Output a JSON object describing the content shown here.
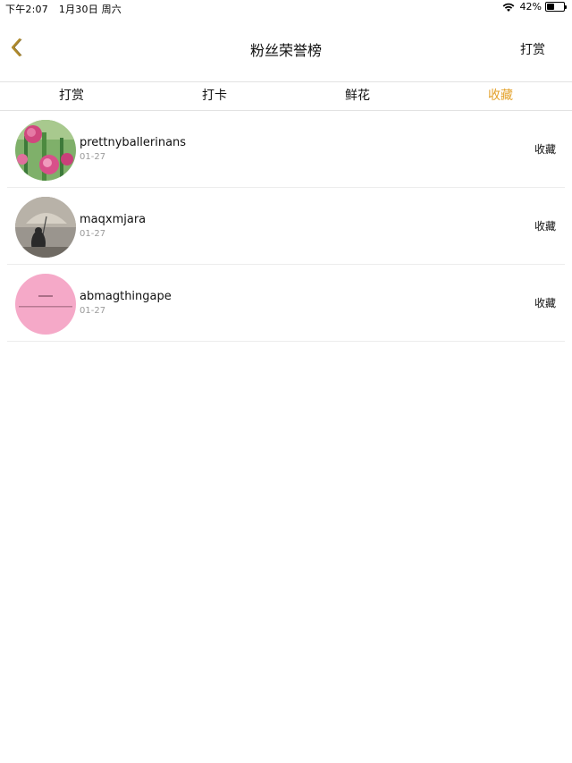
{
  "status_bar": {
    "time": "下午2:07",
    "date": "1月30日 周六",
    "battery": "42%",
    "battery_level": 0.42
  },
  "nav": {
    "back_icon": "chevron-left-icon",
    "title": "粉丝荣誉榜",
    "right_label": "打赏"
  },
  "tabs": [
    {
      "label": "打赏",
      "active": false
    },
    {
      "label": "打卡",
      "active": false
    },
    {
      "label": "鲜花",
      "active": false
    },
    {
      "label": "收藏",
      "active": true
    }
  ],
  "accent_color": "#e3a22c",
  "list": [
    {
      "name": "prettnyballerinans",
      "date": "01-27",
      "action": "收藏"
    },
    {
      "name": "maqxmjara",
      "date": "01-27",
      "action": "收藏"
    },
    {
      "name": "abmagthingape",
      "date": "01-27",
      "action": "收藏"
    }
  ]
}
